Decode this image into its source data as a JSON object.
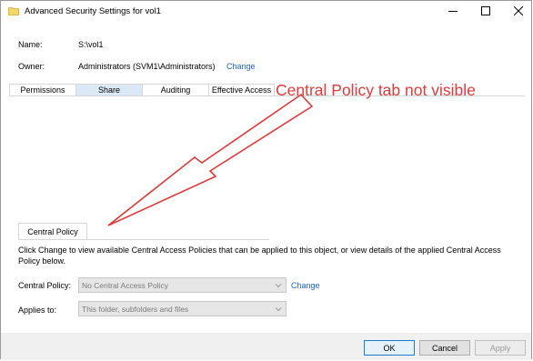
{
  "window": {
    "title": "Advanced Security Settings for vol1"
  },
  "fields": {
    "name_label": "Name:",
    "name_value": "S:\\vol1",
    "owner_label": "Owner:",
    "owner_value": "Administrators (SVM1\\Administrators)",
    "owner_change": "Change"
  },
  "tabs": [
    {
      "label": "Permissions",
      "selected": false
    },
    {
      "label": "Share",
      "selected": true
    },
    {
      "label": "Auditing",
      "selected": false
    },
    {
      "label": "Effective Access",
      "selected": false
    }
  ],
  "annotation": {
    "text": "Central Policy tab not visible",
    "color": "#e03a3a"
  },
  "central_policy": {
    "tab_label": "Central Policy",
    "description": "Click Change to view available Central Access Policies that can be applied to this object, or view details of the applied Central Access Policy below.",
    "policy_label": "Central Policy:",
    "policy_value": "No Central Access Policy",
    "policy_change": "Change",
    "applies_label": "Applies to:",
    "applies_value": "This folder, subfolders and files"
  },
  "buttons": {
    "ok": "OK",
    "cancel": "Cancel",
    "apply": "Apply"
  },
  "colors": {
    "link": "#1a62c9",
    "selected_tab": "#dbe9f7",
    "accent_border": "#1a7ad4"
  }
}
